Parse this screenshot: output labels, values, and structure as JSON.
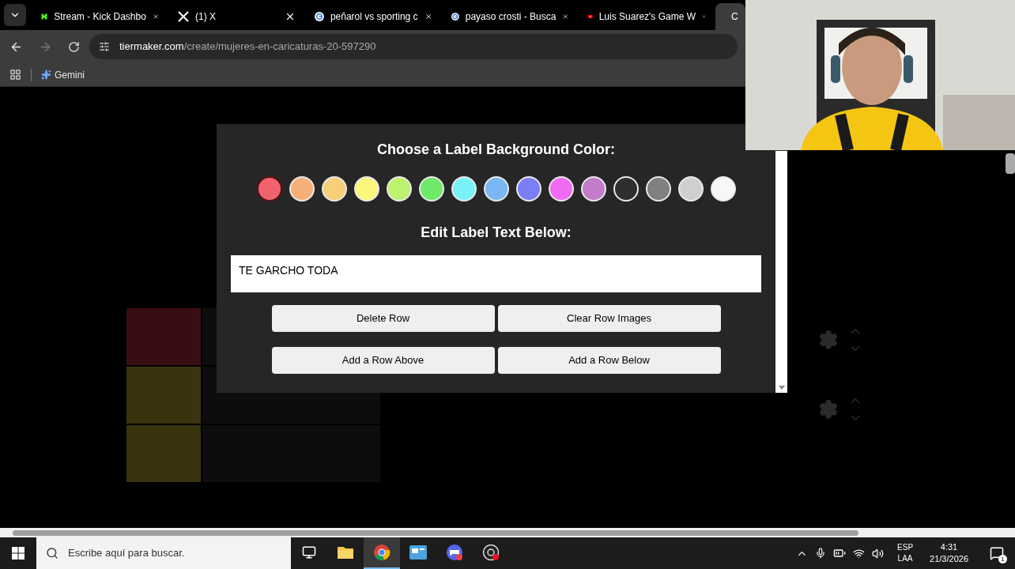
{
  "tabs": [
    {
      "title": "Stream - Kick Dashbo",
      "kind": "kick",
      "selected": false
    },
    {
      "title": "(1) X",
      "kind": "x",
      "selected": false
    },
    {
      "title": "peñarol vs sporting c",
      "kind": "google",
      "selected": false
    },
    {
      "title": "payaso crosti - Busca",
      "kind": "google",
      "selected": false
    },
    {
      "title": "Luis Suarez's Game W",
      "kind": "youtube",
      "selected": false
    },
    {
      "title": "C",
      "kind": "tiermaker",
      "selected": true
    }
  ],
  "address": {
    "host": "tiermaker.com",
    "path": "/create/mujeres-en-caricaturas-20-597290"
  },
  "bookmarks": [
    "Gemini"
  ],
  "modal": {
    "color_title": "Choose a Label Background Color:",
    "colors": [
      {
        "color": "#f0626e",
        "selected": true
      },
      {
        "color": "#f5b07a",
        "selected": false
      },
      {
        "color": "#f7cf78",
        "selected": false
      },
      {
        "color": "#fbf77a",
        "selected": false
      },
      {
        "color": "#bdf26e",
        "selected": false
      },
      {
        "color": "#6ee96a",
        "selected": false
      },
      {
        "color": "#78f2f7",
        "selected": false
      },
      {
        "color": "#7ab8f5",
        "selected": false
      },
      {
        "color": "#7b7ef5",
        "selected": false
      },
      {
        "color": "#f16af2",
        "selected": false
      },
      {
        "color": "#c27dc9",
        "selected": false
      },
      {
        "color": "#2f2f2f",
        "selected": false
      },
      {
        "color": "#808080",
        "selected": false
      },
      {
        "color": "#cfcfcf",
        "selected": false
      },
      {
        "color": "#f7f7f7",
        "selected": false
      }
    ],
    "text_title": "Edit Label Text Below:",
    "label_text": "TE GARCHO TODA",
    "buttons": [
      "Delete Row",
      "Clear Row Images",
      "Add a Row Above",
      "Add a Row Below"
    ]
  },
  "tier_rows": [
    {
      "color": "#3a0d12"
    },
    {
      "color": "#3a3310"
    },
    {
      "color": "#38330e"
    }
  ],
  "taskbar": {
    "search_placeholder": "Escribe aquí para buscar.",
    "apps": [
      {
        "kind": "taskview",
        "active": false
      },
      {
        "kind": "explorer",
        "active": false
      },
      {
        "kind": "chrome",
        "active": true
      },
      {
        "kind": "app",
        "active": false
      },
      {
        "kind": "discord",
        "active": false
      },
      {
        "kind": "obs",
        "active": false
      }
    ],
    "language": "ESP",
    "layout": "LAA",
    "time": "4:31",
    "date": "21/3/2026",
    "notifications": "1"
  }
}
